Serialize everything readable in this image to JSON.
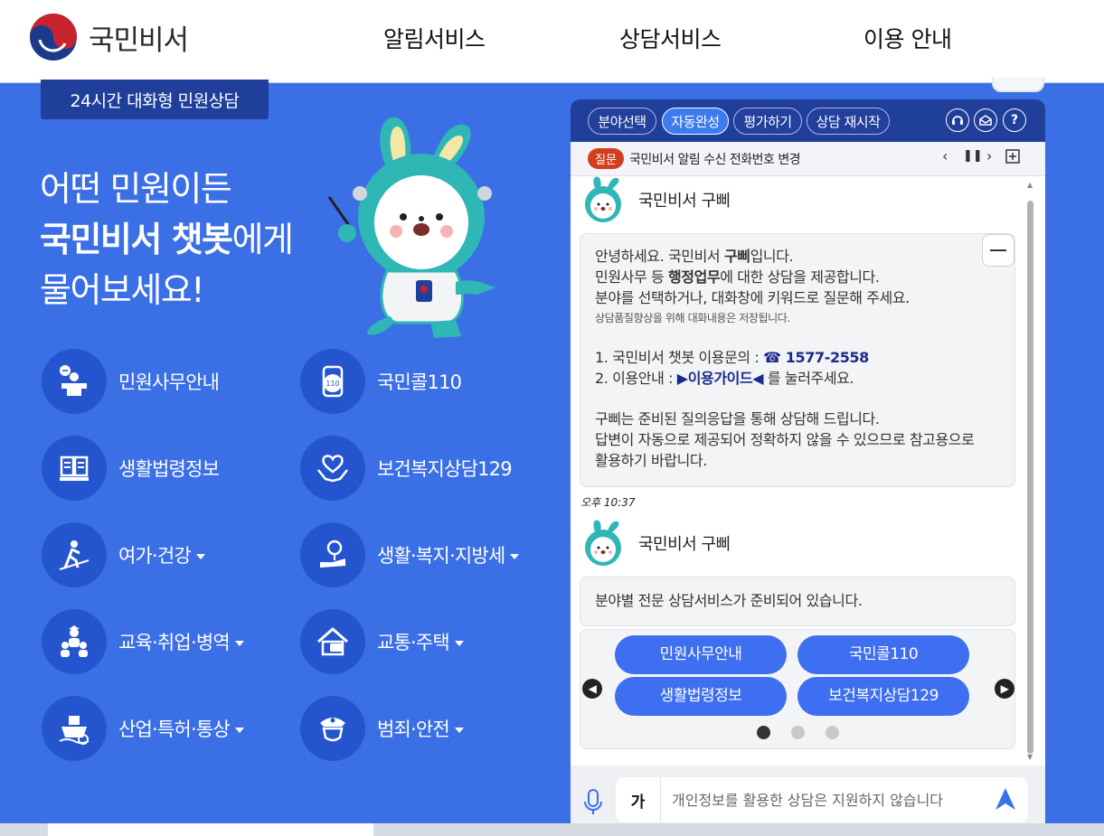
{
  "header": {
    "logo_text": "국민비서",
    "nav": [
      "알림서비스",
      "상담서비스",
      "이용 안내"
    ]
  },
  "hero": {
    "tag": "24시간 대화형 민원상담",
    "line1": "어떤 민원이든",
    "line2_bold": "국민비서 챗봇",
    "line2_rest": "에게",
    "line3": "물어보세요!"
  },
  "services": [
    {
      "label": "민원사무안내",
      "icon": "desk-icon",
      "dropdown": false
    },
    {
      "label": "국민콜110",
      "icon": "phone-110-icon",
      "dropdown": false
    },
    {
      "label": "생활법령정보",
      "icon": "book-icon",
      "dropdown": false
    },
    {
      "label": "보건복지상담129",
      "icon": "heart-hands-icon",
      "dropdown": false
    },
    {
      "label": "여가·건강",
      "icon": "hiking-icon",
      "dropdown": true
    },
    {
      "label": "생활·복지·지방세",
      "icon": "welfare-icon",
      "dropdown": true
    },
    {
      "label": "교육·취업·병역",
      "icon": "people-icon",
      "dropdown": true
    },
    {
      "label": "교통·주택",
      "icon": "house-icon",
      "dropdown": true
    },
    {
      "label": "산업·특허·통상",
      "icon": "ship-icon",
      "dropdown": true
    },
    {
      "label": "범죄·안전",
      "icon": "police-icon",
      "dropdown": true
    }
  ],
  "chat": {
    "tabs": [
      "분야선택",
      "자동완성",
      "평가하기",
      "상담 재시작"
    ],
    "active_tab": "자동완성",
    "top_icons": [
      "headset-icon",
      "mail-icon",
      "help-icon"
    ],
    "question_badge": "질문",
    "question_text": "국민비서 알림 수신 전화번호 변경",
    "bot_name": "국민비서 구삐",
    "message1": {
      "l1_pre": "안녕하세요. 국민비서 ",
      "l1_bold": "구삐",
      "l1_post": "입니다.",
      "l2_pre": "민원사무 등 ",
      "l2_bold": "행정업무",
      "l2_post": "에 대한 상담을 제공합니다.",
      "l3": "분야를 선택하거나, 대화창에 키워드로 질문해 주세요.",
      "l4": "상담품질향상을 위해 대화내용은 저장됩니다.",
      "l5_pre": "1. 국민비서 챗봇 이용문의 : ",
      "l5_phone": "☎ 1577-2558",
      "l6_pre": "2. 이용안내 : ",
      "l6_link": "▶이용가이드◀",
      "l6_post": " 를 눌러주세요.",
      "l7": "구삐는 준비된 질의응답을 통해 상담해 드립니다.",
      "l8": "답변이 자동으로 제공되어 정확하지 않을 수 있으므로 참고용으로",
      "l9": "활용하기 바랍니다."
    },
    "time": "오후 10:37",
    "message2": "분야별 전문 상담서비스가 준비되어 있습니다.",
    "buttons": [
      "민원사무안내",
      "국민콜110",
      "생활법령정보",
      "보건복지상담129"
    ],
    "carousel_page": 1,
    "carousel_pages": 3,
    "input_mode": "가",
    "input_placeholder": "개인정보를 활용한 상담은 지원하지 않습니다"
  },
  "colors": {
    "bg_blue": "#3b6fe6",
    "circle_blue": "#2455cf",
    "dark_navy": "#1f3f9a",
    "button_blue": "#3d6ff0",
    "question_red": "#d33e1e"
  }
}
